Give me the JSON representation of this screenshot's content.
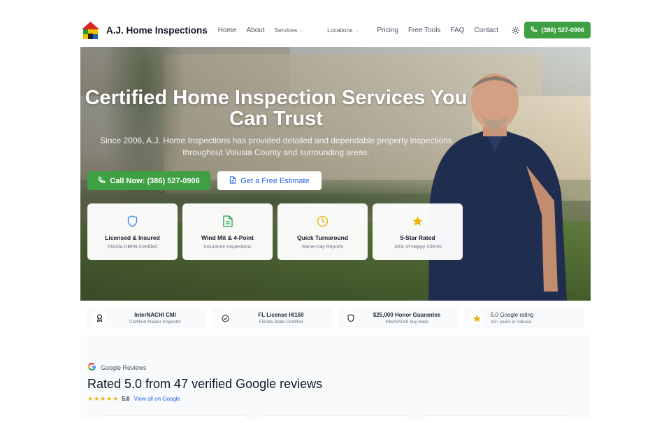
{
  "brand": {
    "name": "A.J. Home Inspections",
    "logo_icon": "house-logo-icon"
  },
  "nav": {
    "items": [
      "Home",
      "About",
      "Services",
      "Locations",
      "Pricing",
      "Free Tools",
      "FAQ",
      "Contact"
    ],
    "call_label": "(386) 527-0906",
    "theme_icon": "sun-icon"
  },
  "hero": {
    "title": "Certified Home Inspection Services You Can Trust",
    "subtitle": "Since 2006, A.J. Home Inspections has provided detailed and dependable property inspections throughout Volusia County and surrounding areas.",
    "call_button": "Call Now: (386) 527-0906",
    "estimate_button": "Get a Free Estimate",
    "features": [
      {
        "title": "Licensed & Insured",
        "subtitle": "Florida DBPR Certified",
        "icon": "shield-icon"
      },
      {
        "title": "Wind Mit & 4-Point",
        "subtitle": "Insurance Inspections",
        "icon": "document-icon"
      },
      {
        "title": "Quick Turnaround",
        "subtitle": "Same-Day Reports",
        "icon": "clock-icon"
      },
      {
        "title": "5-Star Rated",
        "subtitle": "100s of Happy Clients",
        "icon": "star-icon"
      }
    ]
  },
  "trust": [
    {
      "title": "InterNACHI CMI",
      "subtitle": "Certified Master Inspector",
      "icon": "award-icon"
    },
    {
      "title": "FL License HI160",
      "subtitle": "Florida State Certified",
      "icon": "check-circle-icon"
    },
    {
      "title": "$25,000 Honor Guarantee",
      "subtitle": "InterNACHI buy-back",
      "icon": "shield-icon"
    },
    {
      "title": "5.0 Google rating",
      "subtitle": "18+ years in Volusia",
      "icon": "star-icon"
    }
  ],
  "reviews": {
    "badge": "Google Reviews",
    "title": "Rated 5.0 from 47 verified Google reviews",
    "stars": "★★★★★",
    "score": "5.0",
    "link": "View all on Google"
  },
  "colors": {
    "accent_green": "#3fa043",
    "link_blue": "#2563eb",
    "star_gold": "#f4b400"
  }
}
